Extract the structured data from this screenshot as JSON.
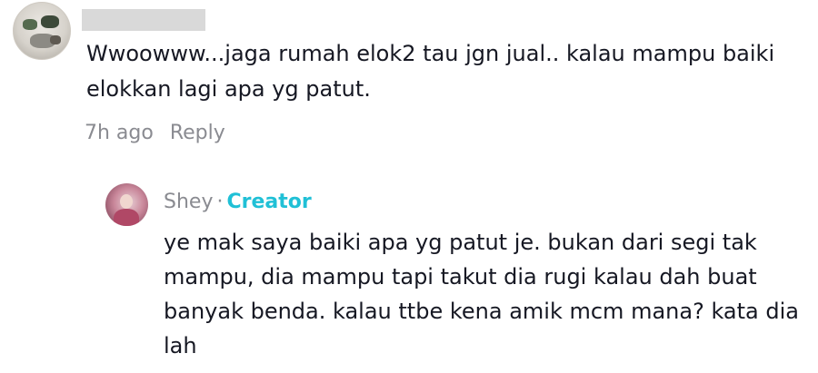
{
  "comment": {
    "avatar_icon": "user-avatar-icon",
    "username_redacted": true,
    "text": "Wwoowww...jaga rumah elok2 tau jgn jual.. kalau mampu baiki elokkan lagi apa yg patut.",
    "timestamp": "7h ago",
    "reply_label": "Reply"
  },
  "reply": {
    "avatar_icon": "creator-avatar-icon",
    "author": "Shey",
    "separator": "·",
    "badge": "Creator",
    "badge_color": "#20c0d6",
    "text": "ye mak saya baiki apa yg patut je. bukan dari segi tak mampu, dia mampu tapi takut dia rugi kalau dah buat banyak benda. kalau ttbe kena amik mcm mana? kata dia lah"
  }
}
